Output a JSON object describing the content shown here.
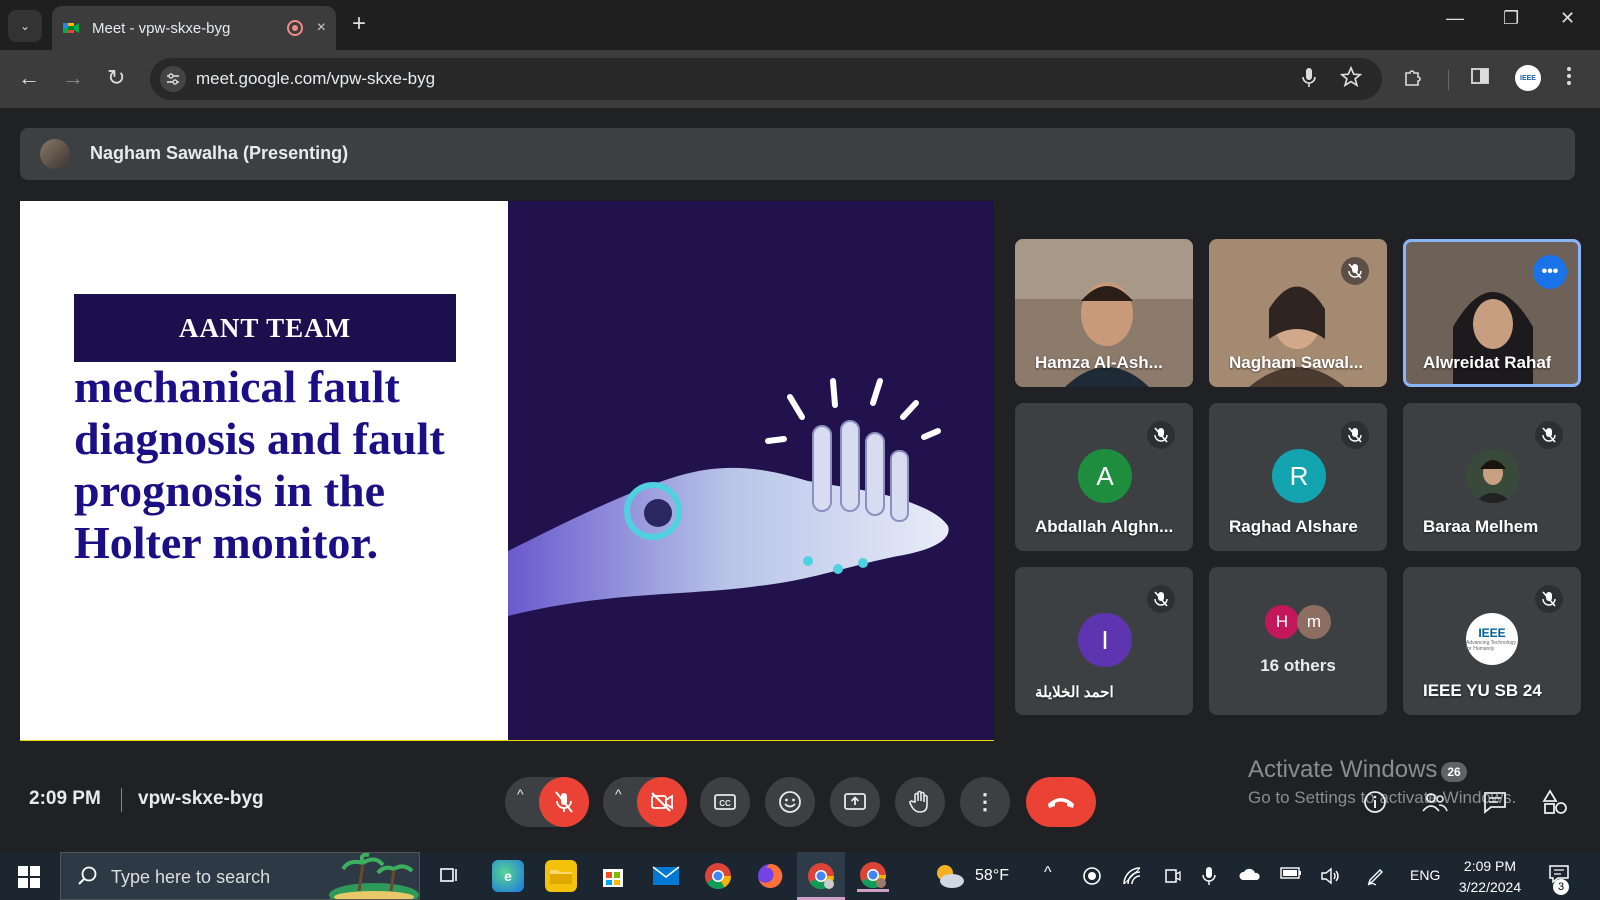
{
  "browser": {
    "tab_title": "Meet - vpw-skxe-byg",
    "url": "meet.google.com/vpw-skxe-byg",
    "close_tab_glyph": "×",
    "new_tab_glyph": "+",
    "minimize_glyph": "—",
    "restore_glyph": "❐",
    "close_window_glyph": "✕",
    "back_glyph": "←",
    "forward_glyph": "→",
    "reload_glyph": "↻",
    "tab_menu_glyph": "⌄",
    "profile_label": "IEEE",
    "icons": [
      "microphone-icon",
      "star-icon",
      "extensions-icon",
      "side-panel-icon",
      "more-menu-icon"
    ]
  },
  "presenter": {
    "label": "Nagham Sawalha (Presenting)"
  },
  "slide": {
    "team_label": "AANT TEAM",
    "heading": "mechanical fault diagnosis and fault prognosis in the Holter monitor.",
    "bottom_bar_color": "#f3d400",
    "right_panel_color": "#21124e"
  },
  "participants": [
    {
      "name": "Hamza Al-Ash...",
      "type": "video",
      "muted": false
    },
    {
      "name": "Nagham Sawal...",
      "type": "video",
      "muted": true
    },
    {
      "name": "Alwreidat Rahaf",
      "type": "video",
      "muted": false,
      "active": true
    },
    {
      "name": "Abdallah Alghn...",
      "initial": "A",
      "avatar_color": "#1e8e3e",
      "muted": true
    },
    {
      "name": "Raghad Alshare",
      "initial": "R",
      "avatar_color": "#12a4af",
      "muted": true
    },
    {
      "name": "Baraa Melhem",
      "type": "photo",
      "muted": true
    },
    {
      "name": "احمد الخلايلة",
      "initial": "I",
      "avatar_color": "#5e35b1",
      "muted": true
    },
    {
      "name": "16 others",
      "type": "group",
      "initials": [
        "H",
        "m"
      ],
      "avatar_colors": [
        "#c2185b",
        "#8d6e63"
      ]
    },
    {
      "name": "IEEE YU SB 24",
      "type": "logo",
      "logo_text": "IEEE",
      "logo_tagline": "Advancing Technology for Humanity",
      "muted": true
    }
  ],
  "meeting": {
    "time": "2:09 PM",
    "code": "vpw-skxe-byg",
    "people_count": "26",
    "more_options_glyph": "⋮",
    "caret_glyph": "^"
  },
  "watermark": {
    "title": "Activate Windows",
    "subtitle": "Go to Settings to activate Windows."
  },
  "taskbar": {
    "search_placeholder": "Type here to search",
    "weather": "58°F",
    "language": "ENG",
    "time": "2:09 PM",
    "date": "3/22/2024",
    "notification_count": "3",
    "tray_up_glyph": "^"
  },
  "colors": {
    "meet_bg": "#202124",
    "tile_bg": "#3c4043",
    "end_call": "#ea4335",
    "accent_blue": "#8ab4f8"
  }
}
